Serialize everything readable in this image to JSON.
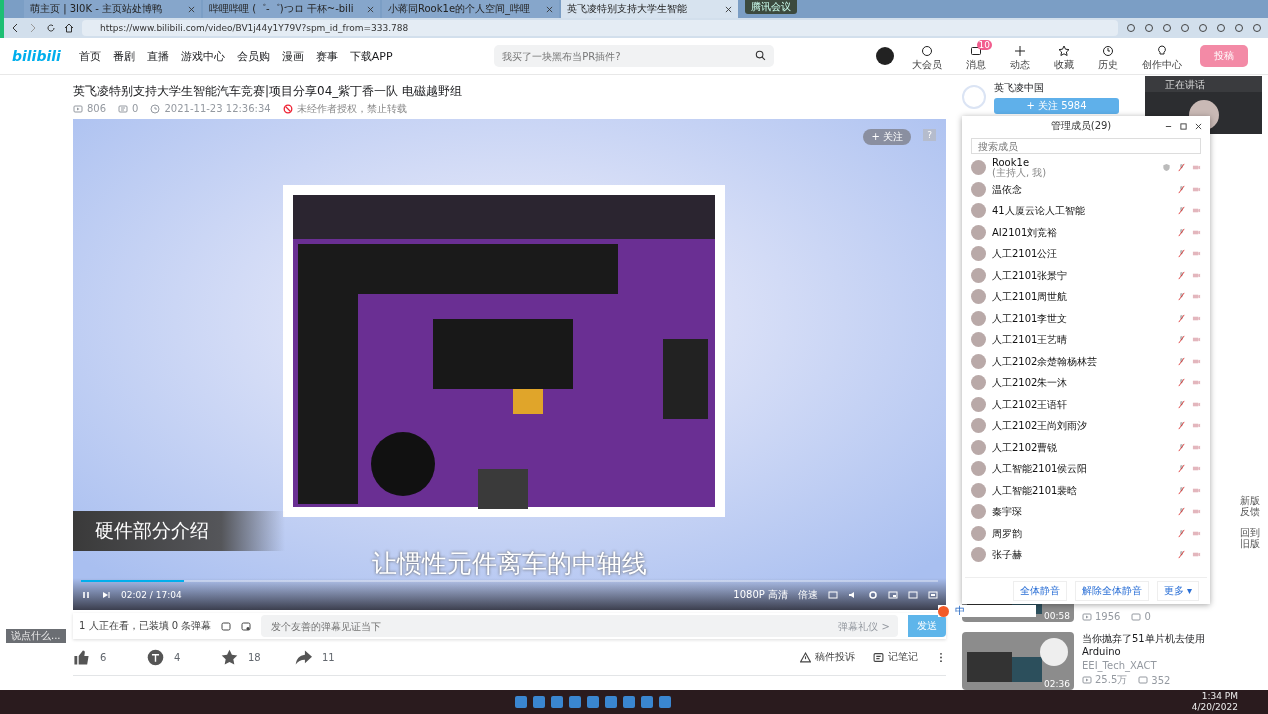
{
  "browser": {
    "tabs": [
      {
        "title": "萌主页 | 3I0K - 主页站处博鸭",
        "selected": false
      },
      {
        "title": "哔哩哔哩 (゜-゜)つロ 干杯~-bili",
        "selected": false
      },
      {
        "title": "小蒋同Rook1e的个人空间_哔哩",
        "selected": false
      },
      {
        "title": "英飞凌特别支持大学生智能",
        "selected": true
      }
    ],
    "url": "https://www.bilibili.com/video/BV1j44y1Y79V?spm_id_from=333.788"
  },
  "meeting_badge": "腾讯会议",
  "header": {
    "logo": "bilibili",
    "nav": [
      "首页",
      "番剧",
      "直播",
      "游戏中心",
      "会员购",
      "漫画",
      "赛事",
      "下载APP"
    ],
    "search": {
      "placeholder": "我买了一块黑布当PR插件?"
    },
    "actions": [
      {
        "label": "大会员",
        "kind": "vip"
      },
      {
        "label": "消息",
        "kind": "message",
        "badge": "10"
      },
      {
        "label": "动态",
        "kind": "feed"
      },
      {
        "label": "收藏",
        "kind": "star"
      },
      {
        "label": "历史",
        "kind": "clock"
      },
      {
        "label": "创作中心",
        "kind": "bulb"
      }
    ],
    "upload_button": "投稿"
  },
  "video": {
    "title": "英飞凌特别支持大学生智能汽车竞赛|项目分享04_紫丁香一队 电磁越野组",
    "views": "806",
    "danmaku_count": "0",
    "date": "2021-11-23 12:36:34",
    "notice": "未经作者授权，禁止转载",
    "overlay_follow": "+ 关注",
    "overlay_help": "?",
    "caption_title": "硬件部分介绍",
    "subtitle": "让惯性元件离车的中轴线",
    "time": "02:02 / 17:04",
    "progress": {
      "level": 0.12
    },
    "quality": "1080P 高清",
    "speed": "倍速"
  },
  "danmaku_bar": {
    "watching": "1 人正在看，已装填 0 条弹幕",
    "placeholder": "发个友善的弹幕见证当下",
    "etiquette": "弹幕礼仪 >",
    "send": "发送"
  },
  "toolbar": {
    "like": "6",
    "coin": "4",
    "favorite": "18",
    "share": "11",
    "report": "稿件投诉",
    "note": "记笔记"
  },
  "uploader": {
    "name": "英飞凌中国",
    "follow": "+ 关注 5984"
  },
  "speaking_window": {
    "label": "正在讲话"
  },
  "members_panel": {
    "title": "管理成员(29)",
    "search_placeholder": "搜索成员",
    "members": [
      {
        "name": "Rook1e",
        "note": "(主持人, 我)",
        "host": true
      },
      {
        "name": "温依念",
        "host": false
      },
      {
        "name": "41人厦云论人工智能",
        "host": false
      },
      {
        "name": "AI2101刘竞裕",
        "host": false
      },
      {
        "name": "人工2101公汪",
        "host": false
      },
      {
        "name": "人工2101张景宁",
        "host": false
      },
      {
        "name": "人工2101周世航",
        "host": false
      },
      {
        "name": "人工2101李世文",
        "host": false
      },
      {
        "name": "人工2101王艺晴",
        "host": false
      },
      {
        "name": "人工2102余楚翰杨林芸",
        "host": false
      },
      {
        "name": "人工2102朱一沐",
        "host": false
      },
      {
        "name": "人工2102王语轩",
        "host": false
      },
      {
        "name": "人工2102王尚刘雨汐",
        "host": false
      },
      {
        "name": "人工2102曹锐",
        "host": false
      },
      {
        "name": "人工智能2101侯云阳",
        "host": false
      },
      {
        "name": "人工智能2101裴晗",
        "host": false
      },
      {
        "name": "秦宇琛",
        "host": false
      },
      {
        "name": "周罗韵",
        "host": false
      },
      {
        "name": "张子赫",
        "host": false
      }
    ],
    "buttons": [
      "全体静音",
      "解除全体静音",
      "更多 ▾"
    ]
  },
  "ime_bar": {
    "label": "中"
  },
  "recommended": [
    {
      "views": "1956",
      "comments": "0",
      "duration": "00:58"
    },
    {
      "title": "当你抛弃了51单片机去使用Arduino",
      "author": "EEI_Tech_XACT",
      "views": "25.5万",
      "comments": "352",
      "duration": "02:36"
    }
  ],
  "side_links": [
    "新版反馈",
    "回到旧版"
  ],
  "chat_widget": "说点什么...",
  "taskbar": {
    "time": "1:34 PM",
    "date": "4/20/2022"
  }
}
